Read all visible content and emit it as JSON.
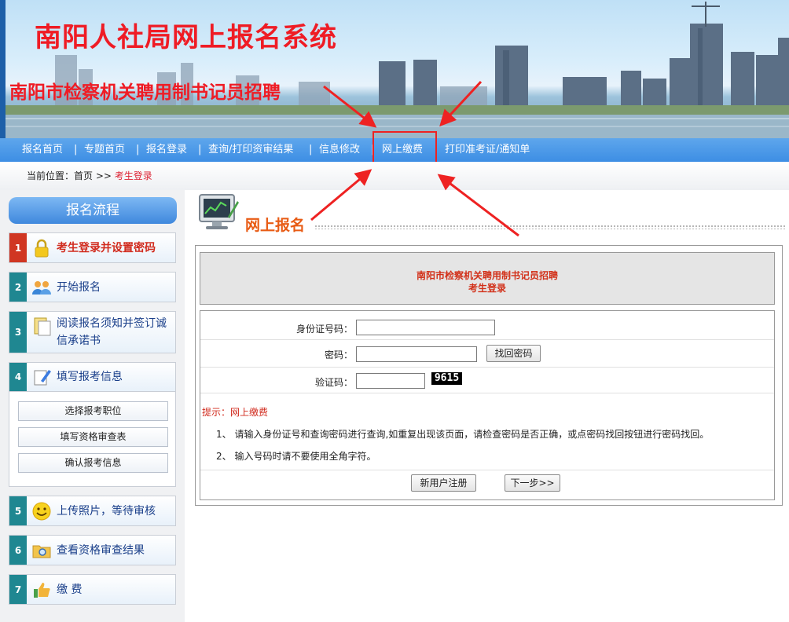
{
  "banner": {
    "site_title": "南阳人社局网上报名系统",
    "sub_title": "南阳市检察机关聘用制书记员招聘"
  },
  "nav": {
    "items": [
      {
        "label": "报名首页"
      },
      {
        "label": "专题首页"
      },
      {
        "label": "报名登录"
      },
      {
        "label": "查询/打印资审结果"
      },
      {
        "label": "信息修改"
      },
      {
        "label": "网上缴费"
      },
      {
        "label": "打印准考证/通知单"
      }
    ],
    "separator": "|",
    "highlighted": "网上缴费"
  },
  "breadcrumb": {
    "prefix": "当前位置：",
    "home": "首页",
    "arrow": ">>",
    "current": "考生登录"
  },
  "sidebar": {
    "title": "报名流程",
    "steps": [
      {
        "num": "1",
        "label": "考生登录并设置密码",
        "icon": "lock-icon"
      },
      {
        "num": "2",
        "label": "开始报名",
        "icon": "users-icon"
      },
      {
        "num": "3",
        "label": "阅读报名须知并签订诚信承诺书",
        "icon": "clipboard-icon"
      },
      {
        "num": "4",
        "label": "填写报考信息",
        "icon": "pencil-note-icon"
      },
      {
        "num": "5",
        "label": "上传照片，等待审核",
        "icon": "smiley-icon"
      },
      {
        "num": "6",
        "label": "查看资格审查结果",
        "icon": "folder-search-icon"
      },
      {
        "num": "7",
        "label": "缴 费",
        "icon": "thumbs-up-icon"
      }
    ],
    "sub_items": [
      {
        "label": "选择报考职位"
      },
      {
        "label": "填写资格审查表"
      },
      {
        "label": "确认报考信息"
      }
    ]
  },
  "content": {
    "section_title": "网上报名",
    "panel_line1": "南阳市检察机关聘用制书记员招聘",
    "panel_line2": "考生登录",
    "form": {
      "id_label": "身份证号码：",
      "id_value": "",
      "password_label": "密码：",
      "password_value": "",
      "find_password_button": "找回密码",
      "captcha_label": "验证码：",
      "captcha_value": "",
      "captcha_code": "9615"
    },
    "tips_label": "提示：",
    "tips_highlight": "网上缴费",
    "tips": [
      "1、 请输入身份证号和查询密码进行查询,如重复出现该页面，请检查密码是否正确，或点密码找回按钮进行密码找回。",
      "2、 输入号码时请不要使用全角字符。"
    ],
    "register_button": "新用户注册",
    "next_button": "下一步>>"
  },
  "colors": {
    "nav_blue": "#3d8ee4",
    "title_red": "#ef1c25",
    "section_orange": "#e85b14",
    "step_teal": "#1f8791",
    "step_active_red": "#d03622",
    "annotation_red": "#ee2222"
  }
}
